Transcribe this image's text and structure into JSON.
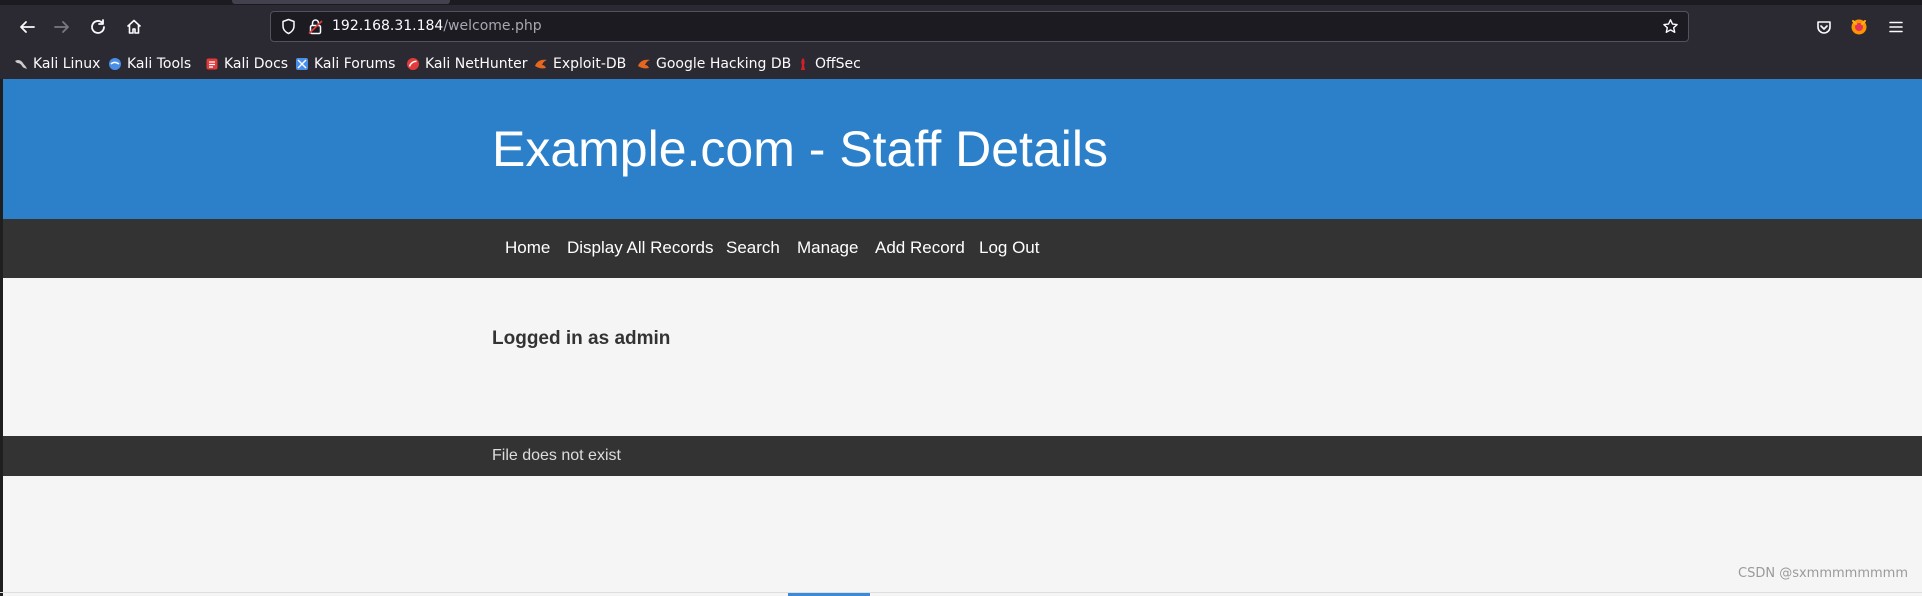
{
  "browser": {
    "url_host": "192.168.31.184",
    "url_path": "/welcome.php",
    "icons": {
      "back": "arrow-left-icon",
      "forward": "arrow-right-icon",
      "reload": "reload-icon",
      "home": "home-icon",
      "tracking": "shield-icon",
      "lock": "lock-icon",
      "bookmark_star": "star-icon",
      "pocket": "pocket-icon",
      "extension": "firefox-account-icon",
      "menu": "hamburger-menu-icon"
    },
    "bookmarks": [
      {
        "label": "Kali Linux",
        "icon": "kali-dragon-icon",
        "color": "#cccccc"
      },
      {
        "label": "Kali Tools",
        "icon": "kali-tools-icon",
        "color": "#4a8fe7"
      },
      {
        "label": "Kali Docs",
        "icon": "kali-docs-icon",
        "color": "#e23b3b"
      },
      {
        "label": "Kali Forums",
        "icon": "kali-forums-icon",
        "color": "#4a8fe7"
      },
      {
        "label": "Kali NetHunter",
        "icon": "nethunter-icon",
        "color": "#e23b3b"
      },
      {
        "label": "Exploit-DB",
        "icon": "exploit-db-icon",
        "color": "#e5661f"
      },
      {
        "label": "Google Hacking DB",
        "icon": "ghdb-icon",
        "color": "#e5661f"
      },
      {
        "label": "OffSec",
        "icon": "offsec-icon",
        "color": "#d0212a"
      }
    ]
  },
  "page": {
    "title": "Example.com - Staff Details",
    "nav": [
      "Home",
      "Display All Records",
      "Search",
      "Manage",
      "Add Record",
      "Log Out"
    ],
    "status": "Logged in as admin",
    "footer": "File does not exist"
  },
  "colors": {
    "header": "#2c80c9",
    "navbar": "#333333",
    "page_bg": "#f5f5f5"
  },
  "watermark": "CSDN @sxmmmmmmmm"
}
